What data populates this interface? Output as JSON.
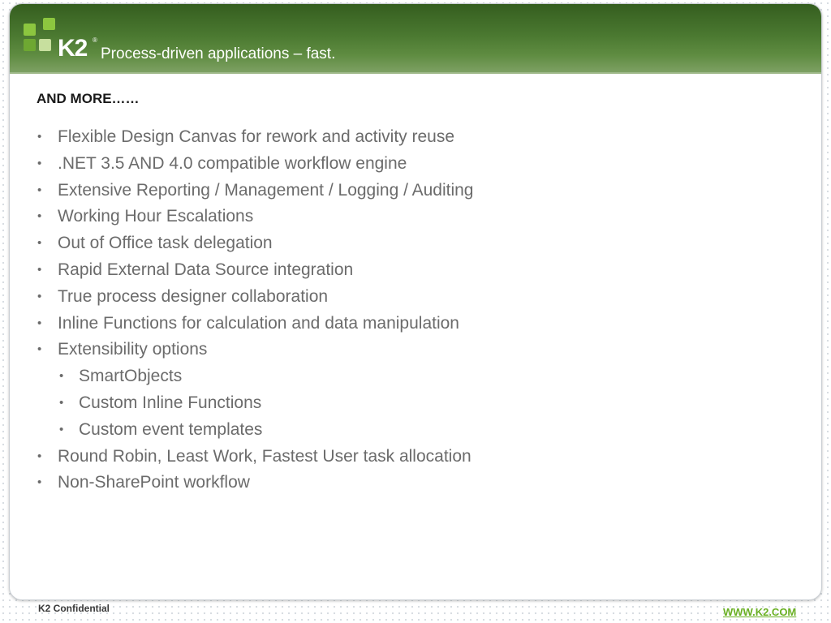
{
  "header": {
    "logo_text": "K2",
    "logo_reg_mark": "®",
    "tagline": "Process-driven applications – fast."
  },
  "slide": {
    "title": "AND MORE……",
    "bullets": [
      {
        "level": 1,
        "text": "Flexible Design Canvas for rework and activity reuse"
      },
      {
        "level": 1,
        "text": ".NET 3.5 AND 4.0 compatible workflow engine"
      },
      {
        "level": 1,
        "text": "Extensive Reporting / Management / Logging / Auditing"
      },
      {
        "level": 1,
        "text": "Working Hour Escalations"
      },
      {
        "level": 1,
        "text": "Out of Office task delegation"
      },
      {
        "level": 1,
        "text": "Rapid External Data Source integration"
      },
      {
        "level": 1,
        "text": "True process designer collaboration"
      },
      {
        "level": 1,
        "text": "Inline Functions for  calculation and data manipulation"
      },
      {
        "level": 1,
        "text": "Extensibility options"
      },
      {
        "level": 2,
        "text": "SmartObjects"
      },
      {
        "level": 2,
        "text": "Custom Inline Functions"
      },
      {
        "level": 2,
        "text": "Custom event templates"
      },
      {
        "level": 1,
        "text": "Round Robin, Least Work, Fastest User task allocation"
      },
      {
        "level": 1,
        "text": "Non-SharePoint workflow"
      }
    ]
  },
  "footer": {
    "confidential": "K2 Confidential",
    "website": "WWW.K2.COM"
  },
  "colors": {
    "header_green": "#4a7830",
    "logo_green": "#8cc63f",
    "body_text": "#6b6b6b",
    "link_green": "#6ab023"
  }
}
